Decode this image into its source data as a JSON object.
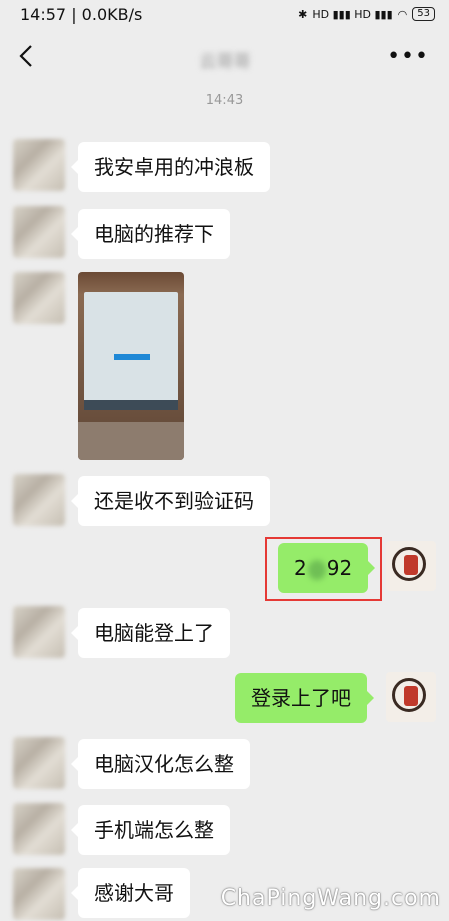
{
  "status_bar": {
    "time": "14:57 | 0.0KB/s",
    "signal": "HD ▮▮▮ HD ▮▮▮",
    "battery": "53"
  },
  "header": {
    "title": "云哥哥",
    "more": "•••"
  },
  "timestamp": "14:43",
  "messages": [
    {
      "text": "我安卓用的冲浪板"
    },
    {
      "text": "电脑的推荐下"
    },
    {
      "image": "photo-of-laptop-screen"
    },
    {
      "text": "还是收不到验证码"
    },
    {
      "text_prefix": "2",
      "text_suffix": "92"
    },
    {
      "text": "电脑能登上了"
    },
    {
      "text": "登录上了吧"
    },
    {
      "text": "电脑汉化怎么整"
    },
    {
      "text": "手机端怎么整"
    },
    {
      "text": "感谢大哥"
    }
  ],
  "watermark": "ChaPingWang.com"
}
